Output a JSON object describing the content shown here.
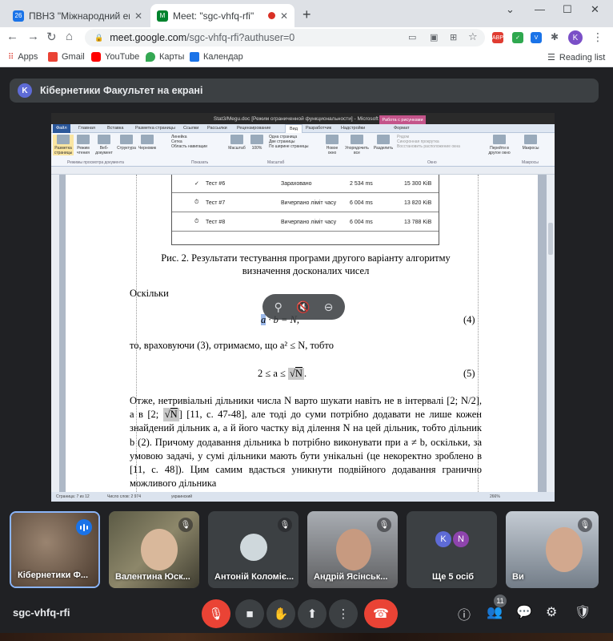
{
  "browser": {
    "tabs": [
      {
        "title": "ПВНЗ \"Міжнародний економіч",
        "favicon": "26",
        "favicon_color": "#1a73e8"
      },
      {
        "title": "Meet: \"sgc-vhfq-rfi\"",
        "favicon": "M",
        "favicon_color": "#00832d"
      }
    ],
    "new_tab": "+",
    "window_controls": [
      "⌄",
      "—",
      "☐",
      "✕"
    ],
    "url_main": "meet.google.com",
    "url_rest": "/sgc-vhfq-rfi?authuser=0",
    "profile_initial": "K",
    "ext_abp": "ABP"
  },
  "bookmarks": [
    {
      "label": "Apps"
    },
    {
      "label": "Gmail"
    },
    {
      "label": "YouTube"
    },
    {
      "label": "Карты"
    },
    {
      "label": "Календар"
    }
  ],
  "reading_list": "Reading list",
  "meet": {
    "presenter_initial": "K",
    "presenting_text": "Кібернетики Факультет на екрані",
    "meeting_code": "sgc-vhfq-rfi",
    "participants_count": "11",
    "accent": "#1a73e8",
    "danger": "#ea4335"
  },
  "word": {
    "window_title": "Stat3/Megu.doc [Режим ограниченной функциональности] - Microsoft Word",
    "context_tab": "Работа с рисунками",
    "ribbon_tabs": [
      "Файл",
      "Главная",
      "Вставка",
      "Разметка страницы",
      "Ссылки",
      "Рассылки",
      "Рецензирование",
      "Вид",
      "Разработчик",
      "Надстройки",
      "Формат"
    ],
    "ribbon_buttons": [
      "Разметка страницы",
      "Режим чтения",
      "Веб-документ",
      "Структура",
      "Черновик",
      "Масштаб",
      "100%",
      "Новое окно",
      "Упорядочить все",
      "Разделить",
      "Перейти в другое окно",
      "Макросы"
    ],
    "ribbon_checks": [
      "Линейка",
      "Сетка",
      "Область навигации",
      "Одна страница",
      "Две страницы",
      "По ширине страницы",
      "Рядом",
      "Синхронная прокрутка",
      "Восстановить расположение окна"
    ],
    "ribbon_groups": [
      "Режимы просмотра документа",
      "Показать",
      "Масштаб",
      "Окно",
      "Макросы"
    ],
    "status": {
      "page": "Страница: 7 из 12",
      "words": "Число слов: 2 974",
      "lang": "украинский",
      "zoom": "266%"
    }
  },
  "doc": {
    "table_rows": [
      {
        "test": "Тест #6",
        "status": "Зараховано",
        "time": "2 534 ms",
        "mem": "15 300 KiB"
      },
      {
        "test": "Тест #7",
        "status": "Вичерпано ліміт часу",
        "time": "6 004 ms",
        "mem": "13 820 KiB"
      },
      {
        "test": "Тест #8",
        "status": "Вичерпано ліміт часу",
        "time": "6 004 ms",
        "mem": "13 788 KiB"
      }
    ],
    "caption_line1": "Рис. 2. Результати тестування програми другого варіанту алгоритму",
    "caption_line2": "визначення досконалих чисел",
    "oskilky": "Оскільки",
    "eq4_a": "a",
    "eq4_rest": " · b = N,",
    "eq4_num": "(4)",
    "line_to": "то, враховуючи (3), отримаємо, що a² ≤ N, тобто",
    "eq5_left": "2 ≤ a ≤ ",
    "eq5_sqrt": "N",
    "eq5_end": ".",
    "eq5_num": "(5)",
    "paragraph_parts": [
      "Отже, нетривіальні дільники числа N варто шукати навіть не в інтервалі [2; N/2], а в [2; ",
      "N",
      "] [11, с. 47-48], але тоді до суми потрібно додавати не лише кожен знайдений дільник a, а й його частку від ділення N на цей дільник, тобто дільник b (2). Причому додавання дільника b потрібно виконувати при a ≠ b, оскільки, за умовою задачі, у сумі дільники мають бути унікальні (це некоректно зроблено в [11, с. 48]). Цим самим вдасться уникнути подвійного додавання гранично можливого дільника"
    ]
  },
  "tiles": [
    {
      "name": "Кібернетики Ф...",
      "bg": "#6b5a4a"
    },
    {
      "name": "Валентина Юск...",
      "bg": "#6d6a55"
    },
    {
      "name": "Антоній Коломіє...",
      "bg": "#3c4043"
    },
    {
      "name": "Андрій Ясінськ...",
      "bg": "#7a7f87"
    },
    {
      "name": "Ще 5 осіб",
      "bg": "#3c4043",
      "avatar1": "K",
      "avatar2": "N"
    },
    {
      "name": "Ви",
      "bg": "#8f9aa6"
    }
  ]
}
